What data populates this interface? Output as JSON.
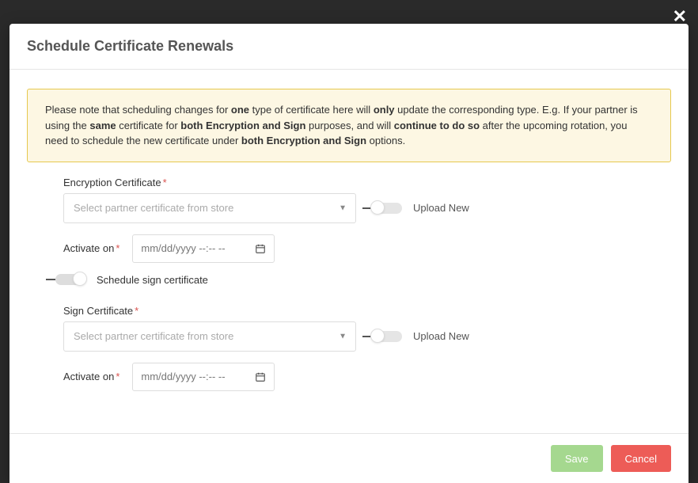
{
  "modal": {
    "title": "Schedule Certificate Renewals"
  },
  "notice": {
    "t1": "Please note that scheduling changes for ",
    "b1": "one",
    "t2": " type of certificate here will ",
    "b2": "only",
    "t3": " update the corresponding type. E.g. If your partner is using the ",
    "b3": "same",
    "t4": " certificate for ",
    "b4": "both Encryption and Sign",
    "t5": " purposes, and will ",
    "b5": "continue to do so",
    "t6": " after the upcoming rotation, you need to schedule the new certificate under ",
    "b6": "both Encryption and Sign",
    "t7": " options."
  },
  "encryption": {
    "label": "Encryption Certificate",
    "placeholder": "Select partner certificate from store",
    "uploadNewLabel": "Upload New",
    "activateLabel": "Activate on",
    "datePlaceholder": "mm/dd/yyyy --:-- --"
  },
  "scheduleSignToggle": {
    "label": "Schedule sign certificate",
    "on": true
  },
  "sign": {
    "label": "Sign Certificate",
    "placeholder": "Select partner certificate from store",
    "uploadNewLabel": "Upload New",
    "activateLabel": "Activate on",
    "datePlaceholder": "mm/dd/yyyy --:-- --"
  },
  "footer": {
    "save": "Save",
    "cancel": "Cancel"
  }
}
